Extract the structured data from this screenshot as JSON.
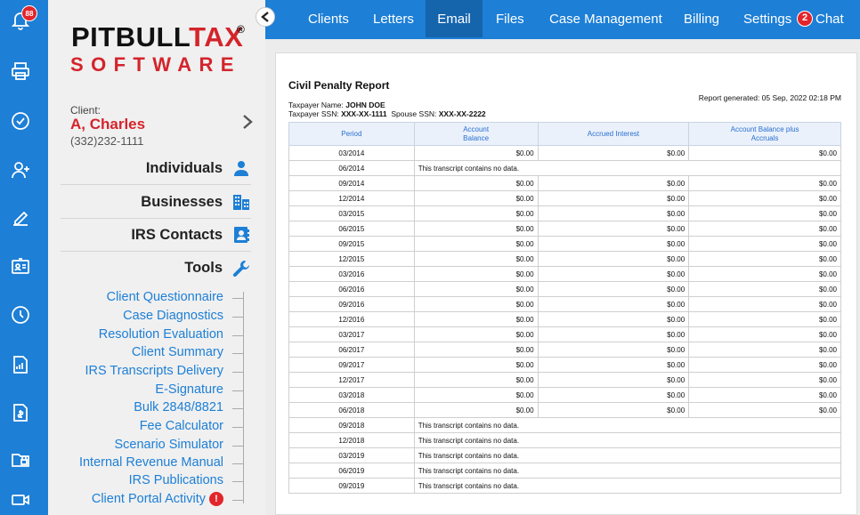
{
  "rail": {
    "notification_count": "88",
    "icons": [
      "bell-icon",
      "printer-icon",
      "check-circle-icon",
      "add-user-icon",
      "edit-icon",
      "id-card-icon",
      "clock-icon",
      "report-icon",
      "invoice-icon",
      "lock-folder-icon",
      "video-icon"
    ]
  },
  "logo": {
    "top_black": "PITBULL",
    "top_red": "TAX",
    "reg": "®",
    "bottom": "SOFTWARE"
  },
  "client": {
    "label": "Client:",
    "name": "A, Charles",
    "phone": "(332)232-1111"
  },
  "sections": [
    {
      "label": "Individuals",
      "icon": "person-icon"
    },
    {
      "label": "Businesses",
      "icon": "buildings-icon"
    },
    {
      "label": "IRS Contacts",
      "icon": "contacts-icon"
    },
    {
      "label": "Tools",
      "icon": "wrench-icon"
    }
  ],
  "tools": [
    "Client Questionnaire",
    "Case Diagnostics",
    "Resolution Evaluation",
    "Client Summary",
    "IRS Transcripts Delivery",
    "E-Signature",
    "Bulk 2848/8821",
    "Fee Calculator",
    "Scenario Simulator",
    "Internal Revenue Manual",
    "IRS Publications",
    "Client Portal Activity"
  ],
  "tool_alert": "!",
  "nav": {
    "items": [
      "Clients",
      "Letters",
      "Email",
      "Files",
      "Case Management",
      "Billing",
      "Settings"
    ],
    "active": "Email",
    "chat_badge": "2",
    "chat_label": "Chat"
  },
  "report": {
    "title": "Civil Penalty Report",
    "generated": "Report generated: 05 Sep, 2022 02:18 PM",
    "taxpayer_label": "Taxpayer Name:",
    "taxpayer_name": "JOHN DOE",
    "ssn_label": "Taxpayer SSN:",
    "ssn": "XXX-XX-1111",
    "spouse_label": "Spouse SSN:",
    "spouse_ssn": "XXX-XX-2222",
    "columns": [
      "Period",
      "Account Balance",
      "Accrued Interest",
      "Account Balance plus Accruals"
    ],
    "no_data_text": "This transcript contains no data.",
    "rows": [
      {
        "period": "03/2014",
        "balance": "$0.00",
        "interest": "$0.00",
        "total": "$0.00"
      },
      {
        "period": "06/2014",
        "nodata": true
      },
      {
        "period": "09/2014",
        "balance": "$0.00",
        "interest": "$0.00",
        "total": "$0.00"
      },
      {
        "period": "12/2014",
        "balance": "$0.00",
        "interest": "$0.00",
        "total": "$0.00"
      },
      {
        "period": "03/2015",
        "balance": "$0.00",
        "interest": "$0.00",
        "total": "$0.00"
      },
      {
        "period": "06/2015",
        "balance": "$0.00",
        "interest": "$0.00",
        "total": "$0.00"
      },
      {
        "period": "09/2015",
        "balance": "$0.00",
        "interest": "$0.00",
        "total": "$0.00"
      },
      {
        "period": "12/2015",
        "balance": "$0.00",
        "interest": "$0.00",
        "total": "$0.00"
      },
      {
        "period": "03/2016",
        "balance": "$0.00",
        "interest": "$0.00",
        "total": "$0.00"
      },
      {
        "period": "06/2016",
        "balance": "$0.00",
        "interest": "$0.00",
        "total": "$0.00"
      },
      {
        "period": "09/2016",
        "balance": "$0.00",
        "interest": "$0.00",
        "total": "$0.00"
      },
      {
        "period": "12/2016",
        "balance": "$0.00",
        "interest": "$0.00",
        "total": "$0.00"
      },
      {
        "period": "03/2017",
        "balance": "$0.00",
        "interest": "$0.00",
        "total": "$0.00"
      },
      {
        "period": "06/2017",
        "balance": "$0.00",
        "interest": "$0.00",
        "total": "$0.00"
      },
      {
        "period": "09/2017",
        "balance": "$0.00",
        "interest": "$0.00",
        "total": "$0.00"
      },
      {
        "period": "12/2017",
        "balance": "$0.00",
        "interest": "$0.00",
        "total": "$0.00"
      },
      {
        "period": "03/2018",
        "balance": "$0.00",
        "interest": "$0.00",
        "total": "$0.00"
      },
      {
        "period": "06/2018",
        "balance": "$0.00",
        "interest": "$0.00",
        "total": "$0.00"
      },
      {
        "period": "09/2018",
        "nodata": true
      },
      {
        "period": "12/2018",
        "nodata": true
      },
      {
        "period": "03/2019",
        "nodata": true
      },
      {
        "period": "06/2019",
        "nodata": true
      },
      {
        "period": "09/2019",
        "nodata": true
      }
    ]
  },
  "colors": {
    "brand_blue": "#1d7fd6",
    "brand_red": "#d4242b",
    "active_nav": "#1565ad"
  }
}
